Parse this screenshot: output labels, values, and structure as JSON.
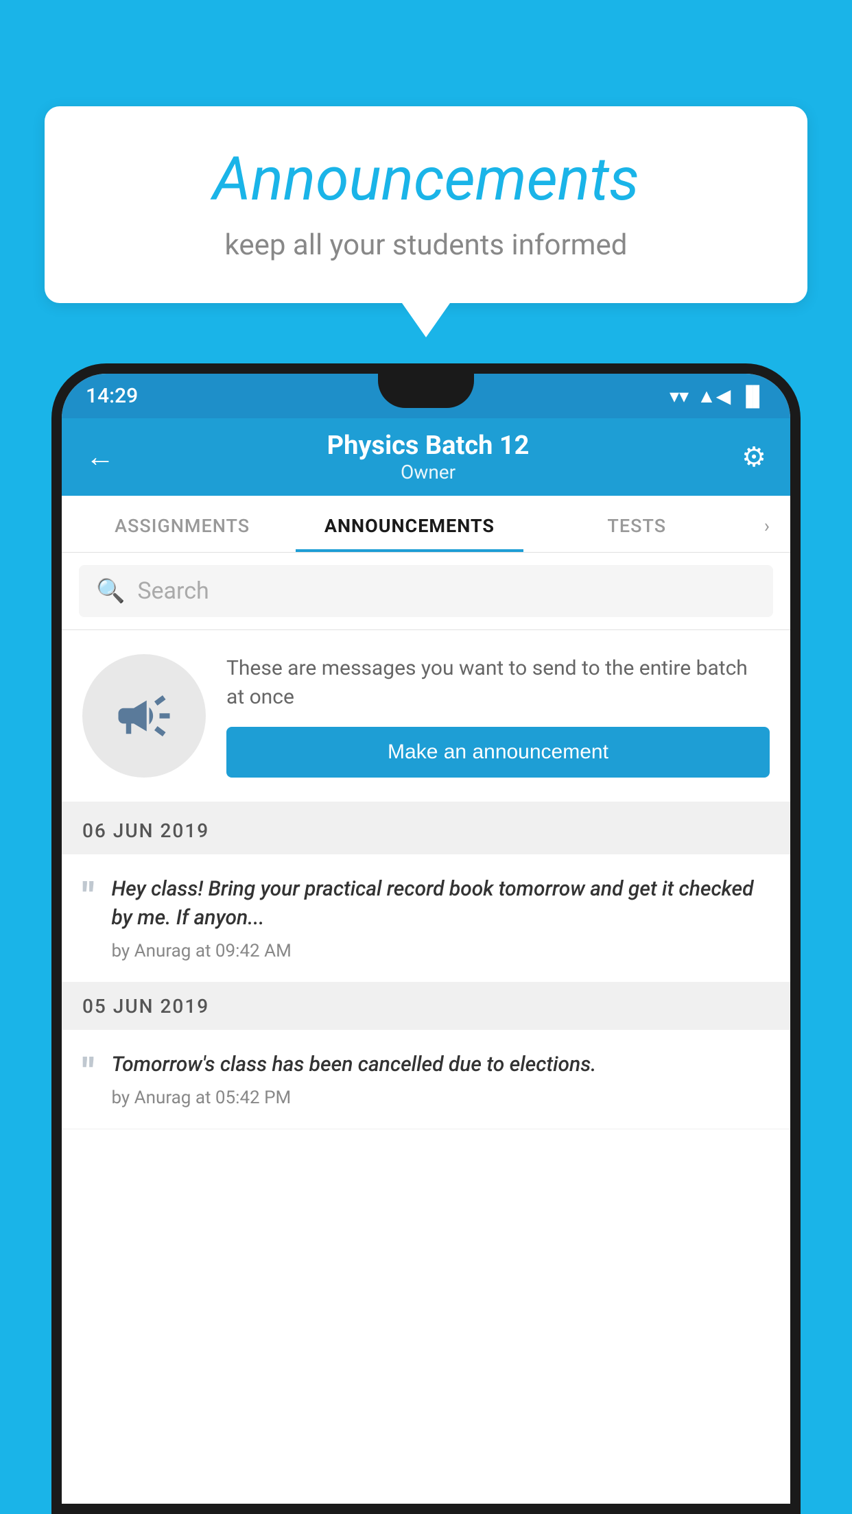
{
  "background_color": "#1ab4e8",
  "speech_bubble": {
    "title": "Announcements",
    "subtitle": "keep all your students informed"
  },
  "phone": {
    "status_bar": {
      "time": "14:29",
      "wifi": "▼",
      "signal": "▲",
      "battery": "▐"
    },
    "header": {
      "title": "Physics Batch 12",
      "subtitle": "Owner",
      "back_label": "←",
      "gear_label": "⚙"
    },
    "tabs": [
      {
        "label": "ASSIGNMENTS",
        "active": false
      },
      {
        "label": "ANNOUNCEMENTS",
        "active": true
      },
      {
        "label": "TESTS",
        "active": false
      }
    ],
    "search": {
      "placeholder": "Search"
    },
    "promo": {
      "description": "These are messages you want to send to the entire batch at once",
      "button_label": "Make an announcement"
    },
    "announcements": [
      {
        "date": "06  JUN  2019",
        "text": "Hey class! Bring your practical record book tomorrow and get it checked by me. If anyon...",
        "meta": "by Anurag at 09:42 AM"
      },
      {
        "date": "05  JUN  2019",
        "text": "Tomorrow's class has been cancelled due to elections.",
        "meta": "by Anurag at 05:42 PM"
      }
    ]
  }
}
